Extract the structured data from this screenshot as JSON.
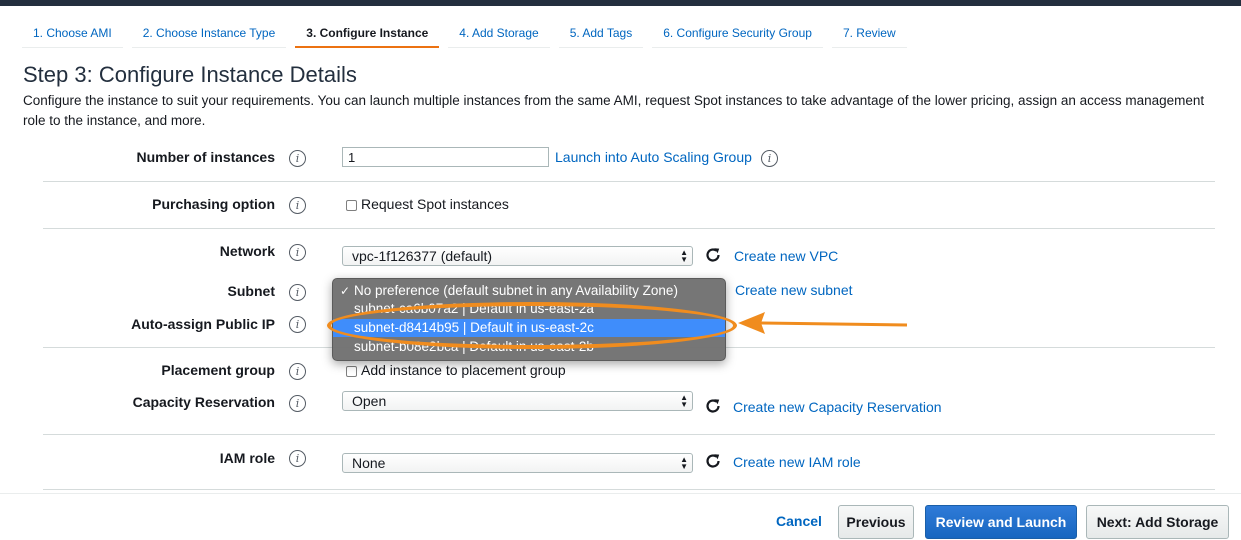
{
  "wizard": {
    "tabs": [
      {
        "label": "1. Choose AMI"
      },
      {
        "label": "2. Choose Instance Type"
      },
      {
        "label": "3. Configure Instance"
      },
      {
        "label": "4. Add Storage"
      },
      {
        "label": "5. Add Tags"
      },
      {
        "label": "6. Configure Security Group"
      },
      {
        "label": "7. Review"
      }
    ],
    "active_tab": "3. Configure Instance"
  },
  "page": {
    "title": "Step 3: Configure Instance Details",
    "description": "Configure the instance to suit your requirements. You can launch multiple instances from the same AMI, request Spot instances to take advantage of the lower pricing, assign an access management role to the instance, and more."
  },
  "form": {
    "number_of_instances": {
      "label": "Number of instances",
      "value": "1",
      "link": "Launch into Auto Scaling Group"
    },
    "purchasing_option": {
      "label": "Purchasing option",
      "checkbox_label": "Request Spot instances"
    },
    "network": {
      "label": "Network",
      "value": "vpc-1f126377 (default)",
      "link": "Create new VPC"
    },
    "subnet": {
      "label": "Subnet",
      "link": "Create new subnet",
      "options": [
        {
          "label": "No preference (default subnet in any Availability Zone)",
          "checked": true
        },
        {
          "label": "subnet-ca6b07a2 | Default in us-east-2a"
        },
        {
          "label": "subnet-d8414b95 | Default in us-east-2c",
          "highlighted": true
        },
        {
          "label": "subnet-b08e2bca | Default in us-east-2b"
        }
      ]
    },
    "auto_assign_ip": {
      "label": "Auto-assign Public IP"
    },
    "placement_group": {
      "label": "Placement group",
      "checkbox_label": "Add instance to placement group"
    },
    "capacity_reservation": {
      "label": "Capacity Reservation",
      "value": "Open",
      "link": "Create new Capacity Reservation"
    },
    "iam_role": {
      "label": "IAM role",
      "value": "None",
      "link": "Create new IAM role"
    }
  },
  "footer": {
    "cancel": "Cancel",
    "previous": "Previous",
    "review_launch": "Review and Launch",
    "next": "Next: Add Storage"
  },
  "colors": {
    "accent": "#ec7211",
    "link": "#0066c0",
    "primary_button": "#1766c0",
    "annotation": "#f08c1e",
    "dropdown_highlight": "#3f8dfb"
  },
  "info_glyph": "i",
  "check_glyph": "✓"
}
